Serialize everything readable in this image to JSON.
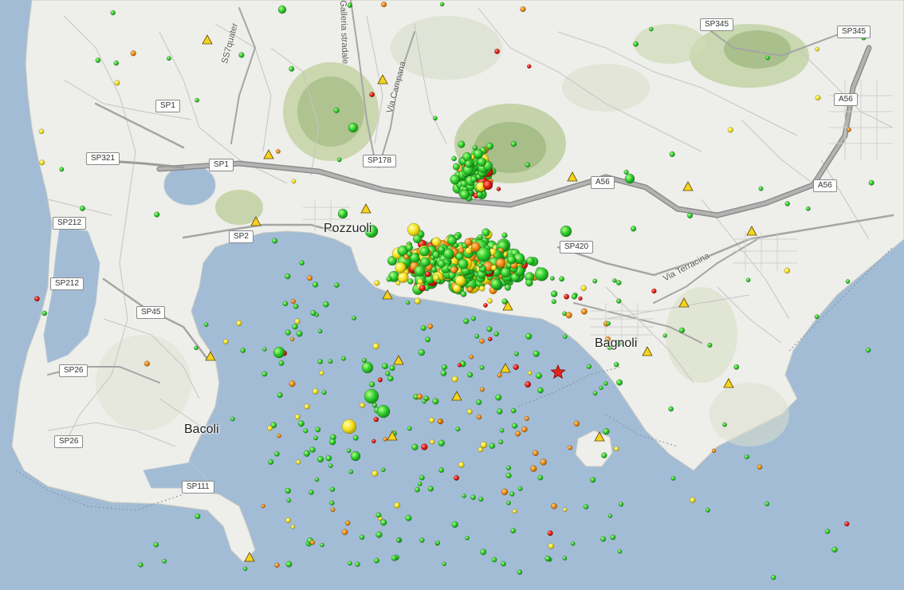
{
  "map": {
    "road_labels": [
      "SP345",
      "SP345",
      "SP1",
      "SP321",
      "SP1",
      "SP178",
      "A56",
      "A56",
      "A56",
      "SP212",
      "SP2",
      "SP420",
      "SP212",
      "SP45",
      "SP26",
      "SP26",
      "SP111"
    ],
    "place_labels": [
      "Pozzuoli",
      "Bagnoli",
      "Bacoli"
    ],
    "street_labels": [
      "SS7quater",
      "Galleria stradale",
      "Via Campana",
      "Via Terracina"
    ]
  },
  "legend_colors": {
    "green": "#2dcd2d",
    "yellow": "#f4e21d",
    "orange": "#ee8b11",
    "red": "#e51a12",
    "sea": "#a3bcd5",
    "land": "#eeeeea",
    "station_triangle": "#f7d31f",
    "epicenter_star": "#e0261c"
  },
  "markers": {
    "station_icon": "triangle-icon",
    "epicenter_icon": "star-icon"
  }
}
